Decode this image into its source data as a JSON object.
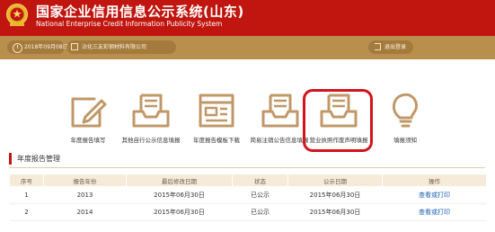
{
  "header": {
    "title_cn": "国家企业信用信息公示系统(山东)",
    "title_en": "National Enterprise Credit Information Publicity System",
    "bg_color": "#c0160f"
  },
  "info_bar": {
    "date": "2018年09月08日",
    "company": "沾化三友彩钢材料有限公司",
    "logout": "退出登录"
  },
  "tiles": [
    {
      "label": "年度报告填写",
      "icon": "pencil-form-icon"
    },
    {
      "label": "其他自行公示信息填报",
      "icon": "inbox-doc-icon"
    },
    {
      "label": "年度报告模板下载",
      "icon": "template-doc-icon"
    },
    {
      "label": "简易注销公告信息填报",
      "icon": "inbox-doc-icon"
    },
    {
      "label": "营业执照作废声明填报",
      "icon": "inbox-doc-icon"
    },
    {
      "label": "填报须知",
      "icon": "lightbulb-icon"
    }
  ],
  "section": {
    "title": "年度报告管理"
  },
  "table": {
    "headers": [
      "序号",
      "报告年份",
      "最后修改日期",
      "状态",
      "公示日期",
      "操作"
    ],
    "rows": [
      [
        "1",
        "2013",
        "2015年06月30日",
        "已公示",
        "2015年06月30日",
        "查看或打印"
      ],
      [
        "2",
        "2014",
        "2015年06月30日",
        "已公示",
        "2015年06月30日",
        "查看或打印"
      ]
    ]
  },
  "colors": {
    "accent": "#c0160f",
    "gold": "#b98f4e",
    "icon": "#c09868",
    "link": "#1a5fb4",
    "highlight": "#d2141d"
  }
}
